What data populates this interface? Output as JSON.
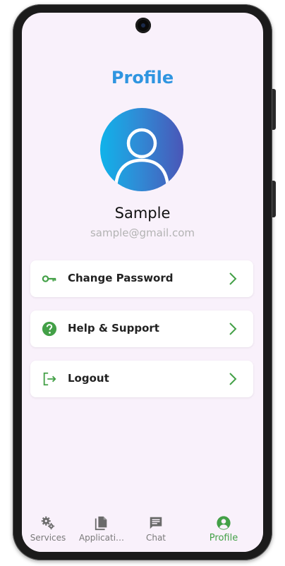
{
  "header": {
    "title": "Profile"
  },
  "profile": {
    "name": "Sample",
    "email": "sample@gmail.com"
  },
  "menu": [
    {
      "label": "Change Password",
      "icon": "key-icon"
    },
    {
      "label": "Help & Support",
      "icon": "help-icon"
    },
    {
      "label": "Logout",
      "icon": "logout-icon"
    }
  ],
  "bottom_nav": [
    {
      "label": "Services",
      "icon": "gears-icon",
      "active": false
    },
    {
      "label": "Applicati…",
      "icon": "documents-icon",
      "active": false
    },
    {
      "label": "Chat",
      "icon": "chat-icon",
      "active": false
    },
    {
      "label": "Profile",
      "icon": "account-circle-icon",
      "active": true
    }
  ],
  "colors": {
    "title_blue": "#2f95e0",
    "accent_green": "#43a047",
    "background": "#f9f1fb",
    "avatar_gradient_start": "#10b3ea",
    "avatar_gradient_end": "#4a56b7"
  }
}
